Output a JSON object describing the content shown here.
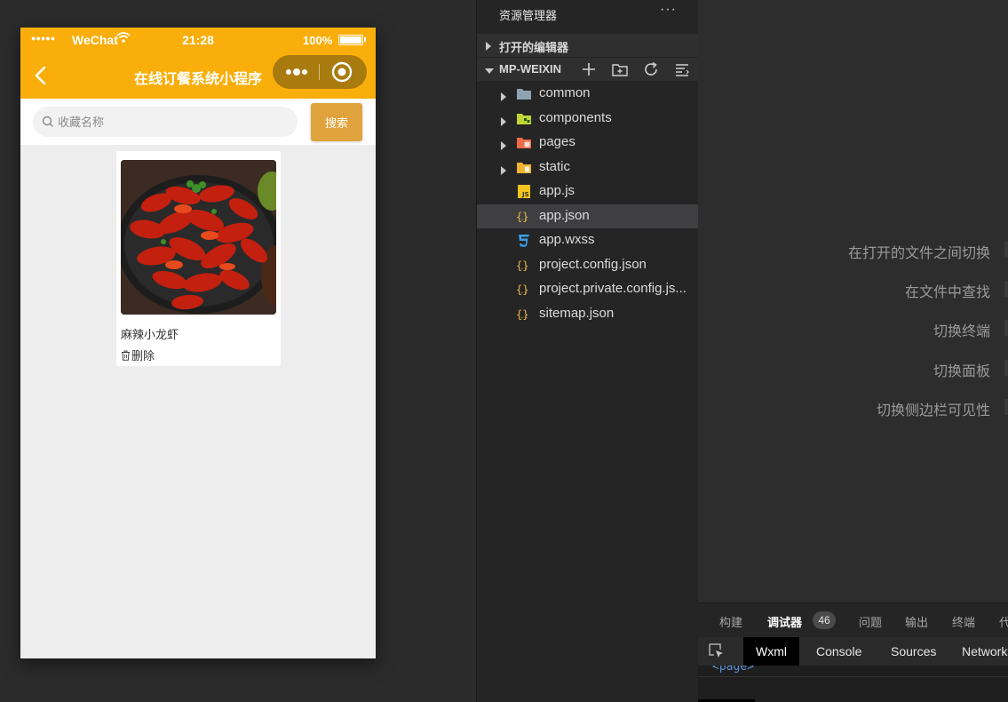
{
  "simulator": {
    "status_bar": {
      "signal": "●●●●●",
      "carrier": "WeChat",
      "time": "21:28",
      "battery": "100%"
    },
    "nav": {
      "title": "在线订餐系统小程序",
      "background": "#f9ae0b",
      "capsule_background": "#a97a0d"
    },
    "search": {
      "placeholder": "收藏名称",
      "value": "",
      "button_label": "搜索",
      "button_color": "#e0a33d"
    },
    "favorites": [
      {
        "name": "麻辣小龙虾",
        "delete_label": "删除",
        "image_icon": "crayfish-photo"
      }
    ]
  },
  "explorer": {
    "title": "资源管理器",
    "more": "···",
    "sections": {
      "open_editors": "打开的编辑器",
      "project": "MP-WEIXIN"
    },
    "files": [
      {
        "name": "common",
        "type": "folder",
        "icon": "folder-icon",
        "color": "#8fa3b0"
      },
      {
        "name": "components",
        "type": "folder",
        "icon": "components-folder-icon",
        "color": "#c0d636"
      },
      {
        "name": "pages",
        "type": "folder",
        "icon": "pages-folder-icon",
        "color": "#ef6b45"
      },
      {
        "name": "static",
        "type": "folder",
        "icon": "static-folder-icon",
        "color": "#f2b430"
      },
      {
        "name": "app.js",
        "type": "file",
        "icon": "js-file-icon",
        "color": "#f2c21f"
      },
      {
        "name": "app.json",
        "type": "file",
        "icon": "json-file-icon",
        "color": "#e8b84a",
        "selected": true
      },
      {
        "name": "app.wxss",
        "type": "file",
        "icon": "css-file-icon",
        "color": "#3b9ee8"
      },
      {
        "name": "project.config.json",
        "type": "file",
        "icon": "json-file-icon",
        "color": "#e8b84a"
      },
      {
        "name": "project.private.config.js...",
        "type": "file",
        "icon": "json-file-icon",
        "color": "#e8b84a"
      },
      {
        "name": "sitemap.json",
        "type": "file",
        "icon": "json-file-icon",
        "color": "#e8b84a"
      }
    ]
  },
  "editor": {
    "shortcuts": [
      "在打开的文件之间切换",
      "在文件中查找",
      "切换终端",
      "切换面板",
      "切换侧边栏可见性"
    ]
  },
  "panel": {
    "tabs": [
      "构建",
      "调试器",
      "问题",
      "输出",
      "终端",
      "代"
    ],
    "active_tab": "调试器",
    "badge": "46",
    "devtools_tabs": [
      "Wxml",
      "Console",
      "Sources",
      "Network"
    ],
    "active_devtools_tab": "Wxml",
    "code_snippet": "<page>"
  }
}
